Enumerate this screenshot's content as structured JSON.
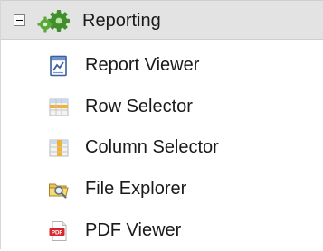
{
  "tree": {
    "group": {
      "label": "Reporting",
      "expanded": true,
      "toggle_icon": "minus-icon",
      "icon": "gears-icon"
    },
    "items": [
      {
        "label": "Report Viewer",
        "icon": "report-chart-icon"
      },
      {
        "label": "Row Selector",
        "icon": "table-rows-icon"
      },
      {
        "label": "Column Selector",
        "icon": "table-columns-icon"
      },
      {
        "label": "File Explorer",
        "icon": "folder-search-icon"
      },
      {
        "label": "PDF Viewer",
        "icon": "pdf-icon"
      }
    ]
  }
}
